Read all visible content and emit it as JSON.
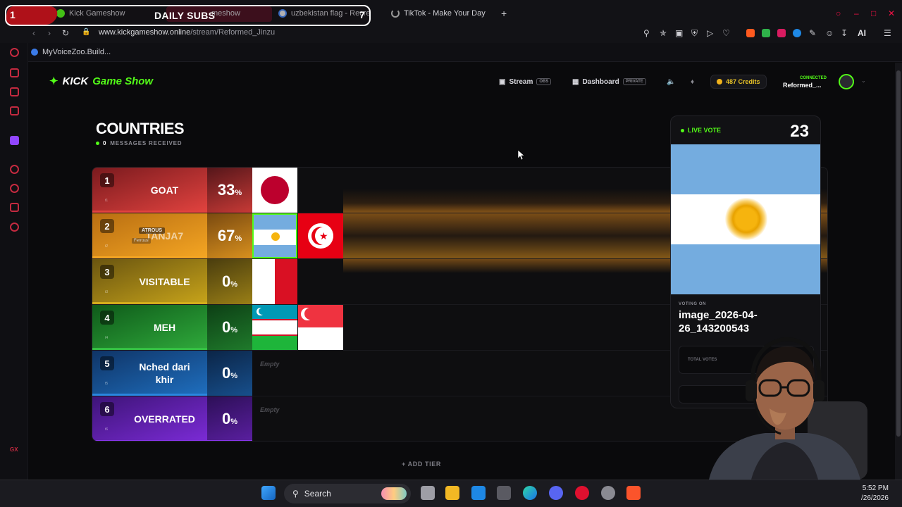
{
  "stream_overlay": {
    "left_num": "1",
    "title": "DAILY SUBS",
    "right_num": "7"
  },
  "browser": {
    "tabs": [
      {
        "label": "Kick Gameshow"
      },
      {
        "label": "meshow"
      },
      {
        "label": "uzbekistan flag - Recre"
      },
      {
        "label": "TikTok - Make Your Day"
      }
    ],
    "new_tab": "+",
    "url_domain": "www.kickgameshow.online",
    "url_path": "/stream/Reformed_Jinzu",
    "ai_label": "AI",
    "bookmark": "MyVoiceZoo.Build..."
  },
  "header": {
    "logo_kick": "KICK",
    "logo_rest": "Game Show",
    "stream_label": "Stream",
    "stream_tag": "OBS",
    "dashboard_label": "Dashboard",
    "dashboard_tag": "PRIVATE",
    "credits": "487 Credits",
    "connected": "CONNECTED",
    "username": "Reformed_..."
  },
  "main": {
    "title": "COUNTRIES",
    "messages_count": "0",
    "messages_label": "MESSAGES RECEIVED",
    "add_tier": "+ ADD TIER",
    "empty_label": "Empty"
  },
  "tiers": [
    {
      "rank": "1",
      "sub": "t1",
      "name": "GOAT",
      "pct": "33",
      "color": "#e2433f"
    },
    {
      "rank": "2",
      "sub": "t2",
      "name": "TANJA7",
      "pct": "67",
      "color": "#f09a1c",
      "floating_top": "ATROUS",
      "floating_bottom": "Ferrous"
    },
    {
      "rank": "3",
      "sub": "t3",
      "name": "VISITABLE",
      "pct": "0",
      "color": "#c8a41a"
    },
    {
      "rank": "4",
      "sub": "t4",
      "name": "MEH",
      "pct": "0",
      "color": "#2faa3b"
    },
    {
      "rank": "5",
      "sub": "t5",
      "name": "Nched dari khir",
      "pct": "0",
      "color": "#1f6fbf"
    },
    {
      "rank": "6",
      "sub": "t6",
      "name": "OVERRATED",
      "pct": "0",
      "color": "#7b2bd6"
    }
  ],
  "pct_symbol": "%",
  "vote": {
    "live_label": "LIVE VOTE",
    "count": "23",
    "voting_on": "VOTING ON",
    "item_name": "image_2026-04-26_143200543",
    "total_votes": "TOTAL VOTES"
  },
  "taskbar": {
    "search": "Search",
    "time": "5:52 PM",
    "date": "/26/2026"
  }
}
